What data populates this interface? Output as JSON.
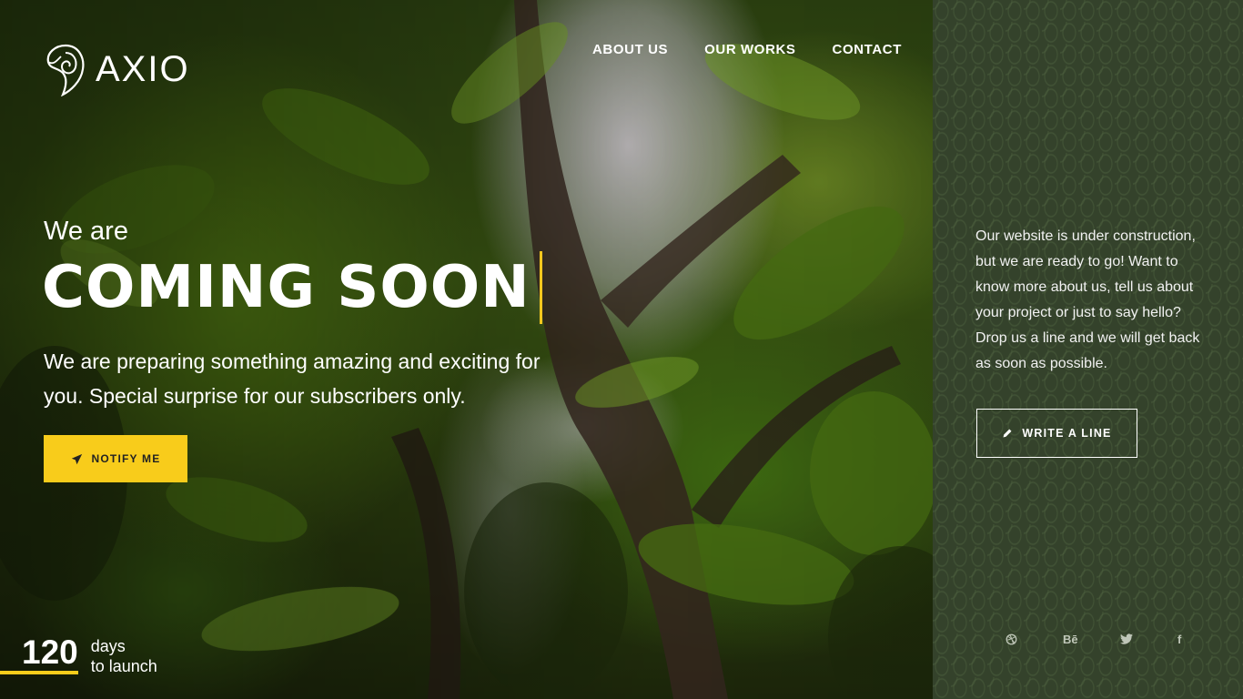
{
  "brand": {
    "name": "AXIO"
  },
  "nav": {
    "items": [
      "ABOUT US",
      "OUR WORKS",
      "CONTACT"
    ]
  },
  "hero": {
    "intro": "We are",
    "headline": "COMING SOON",
    "subtitle_line1": "We are preparing something amazing and exciting for",
    "subtitle_line2": "you. Special surprise for our subscribers only.",
    "notify_label": "NOTIFY ME"
  },
  "countdown": {
    "value": "120",
    "unit_line1": "days",
    "unit_line2": "to launch"
  },
  "panel": {
    "message": "Our website is under construction, but we are ready to go! Want to know more about us, tell us about your project or just to say hello? Drop us a line and we will get back as soon as possible.",
    "write_label": "WRITE A LINE"
  },
  "socials": [
    {
      "icon": "dribbble-icon"
    },
    {
      "icon": "behance-icon",
      "glyph": "Bē"
    },
    {
      "icon": "twitter-icon"
    },
    {
      "icon": "facebook-icon",
      "glyph": "f"
    }
  ],
  "colors": {
    "accent": "#f8cc1b",
    "panel_bg": "#34422b"
  }
}
